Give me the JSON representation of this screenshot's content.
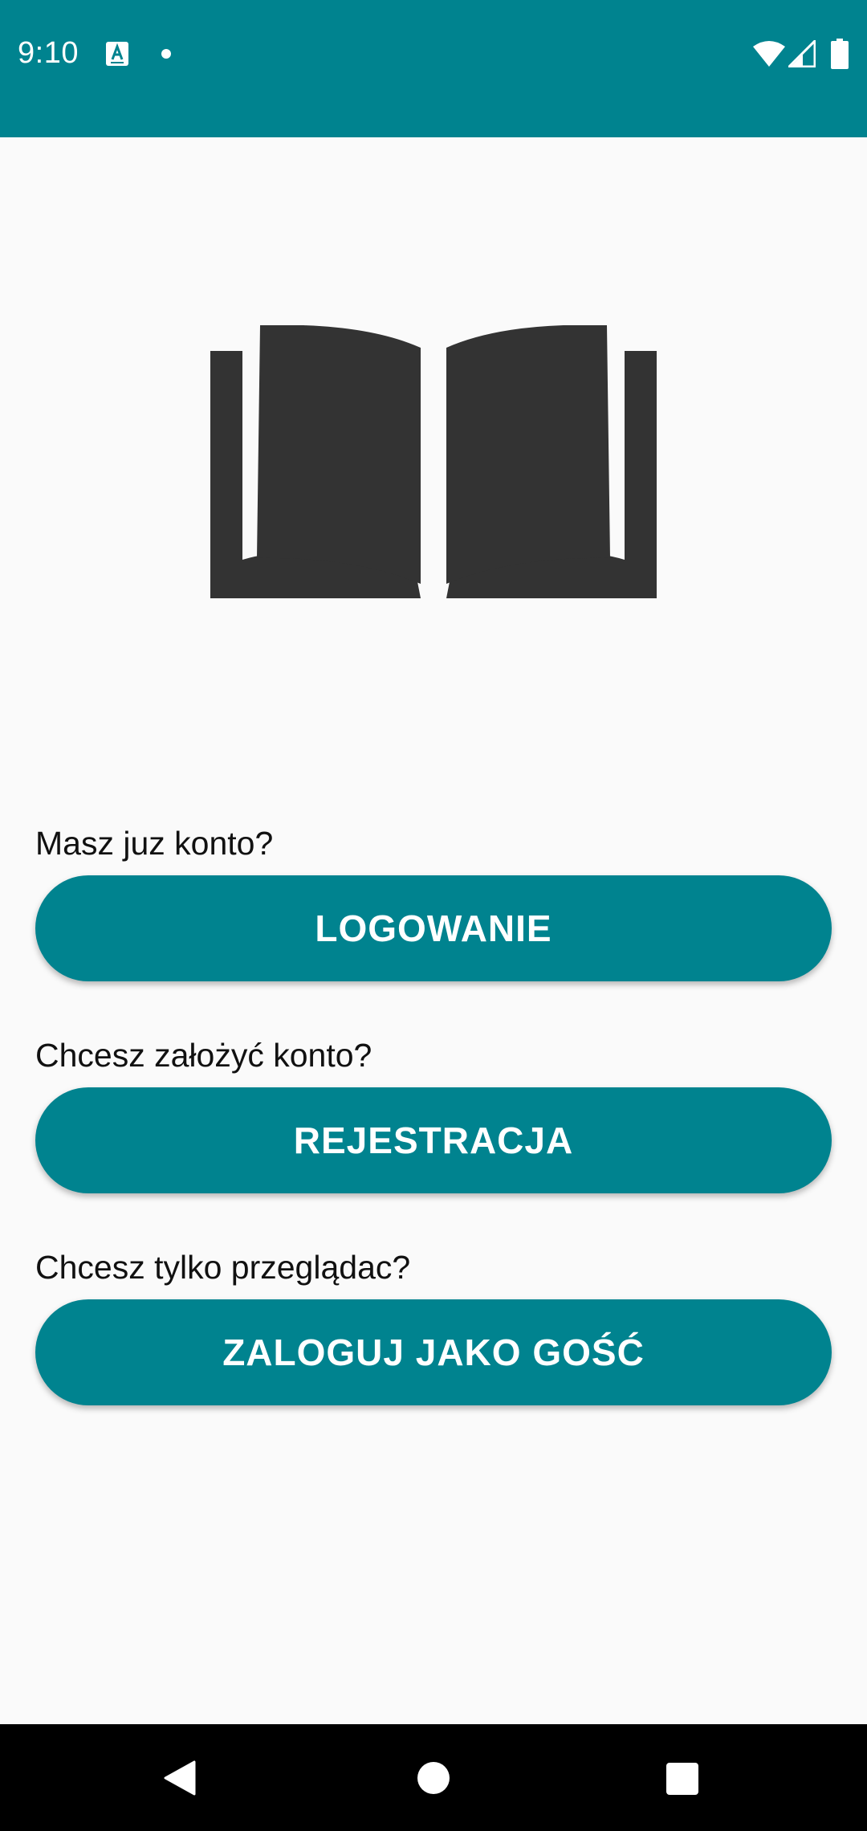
{
  "status_bar": {
    "time": "9:10",
    "icons": [
      "keyboard-a-icon",
      "notification-dot-icon",
      "wifi-icon",
      "cell-signal-icon",
      "battery-icon"
    ],
    "background_color": "#00838f"
  },
  "logo": {
    "icon": "open-book-icon",
    "color": "#333333"
  },
  "login_section": {
    "prompt": "Masz juz konto?",
    "button_label": "LOGOWANIE"
  },
  "register_section": {
    "prompt": "Chcesz założyć konto?",
    "button_label": "REJESTRACJA"
  },
  "guest_section": {
    "prompt": "Chcesz tylko przeglądac?",
    "button_label": "ZALOGUJ JAKO GOŚĆ"
  },
  "theme": {
    "accent": "#00838f",
    "background": "#fafafa",
    "button_text": "#ffffff"
  },
  "nav_bar": {
    "icons": [
      "back-icon",
      "home-icon",
      "recents-icon"
    ]
  }
}
